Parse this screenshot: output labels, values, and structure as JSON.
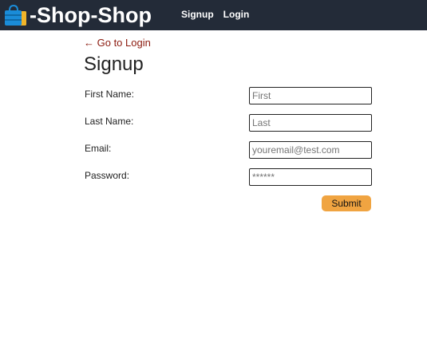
{
  "app": {
    "brand": "-Shop-Shop",
    "brand_icon": "shopping-bag-icon",
    "colors": {
      "navbar": "#232b38",
      "bag_blue": "#1a8cd8",
      "bag_gold": "#f0b429",
      "back_link": "#8b1a0e",
      "submit": "#f0a441"
    }
  },
  "nav": {
    "links": [
      {
        "label": "Signup"
      },
      {
        "label": "Login"
      }
    ]
  },
  "page": {
    "back_link": "← Go to Login",
    "title": "Signup"
  },
  "form": {
    "fields": [
      {
        "label": "First Name:",
        "placeholder": "First",
        "value": ""
      },
      {
        "label": "Last Name:",
        "placeholder": "Last",
        "value": ""
      },
      {
        "label": "Email:",
        "placeholder": "youremail@test.com",
        "value": ""
      },
      {
        "label": "Password:",
        "placeholder": "******",
        "value": ""
      }
    ],
    "submit_label": "Submit"
  }
}
